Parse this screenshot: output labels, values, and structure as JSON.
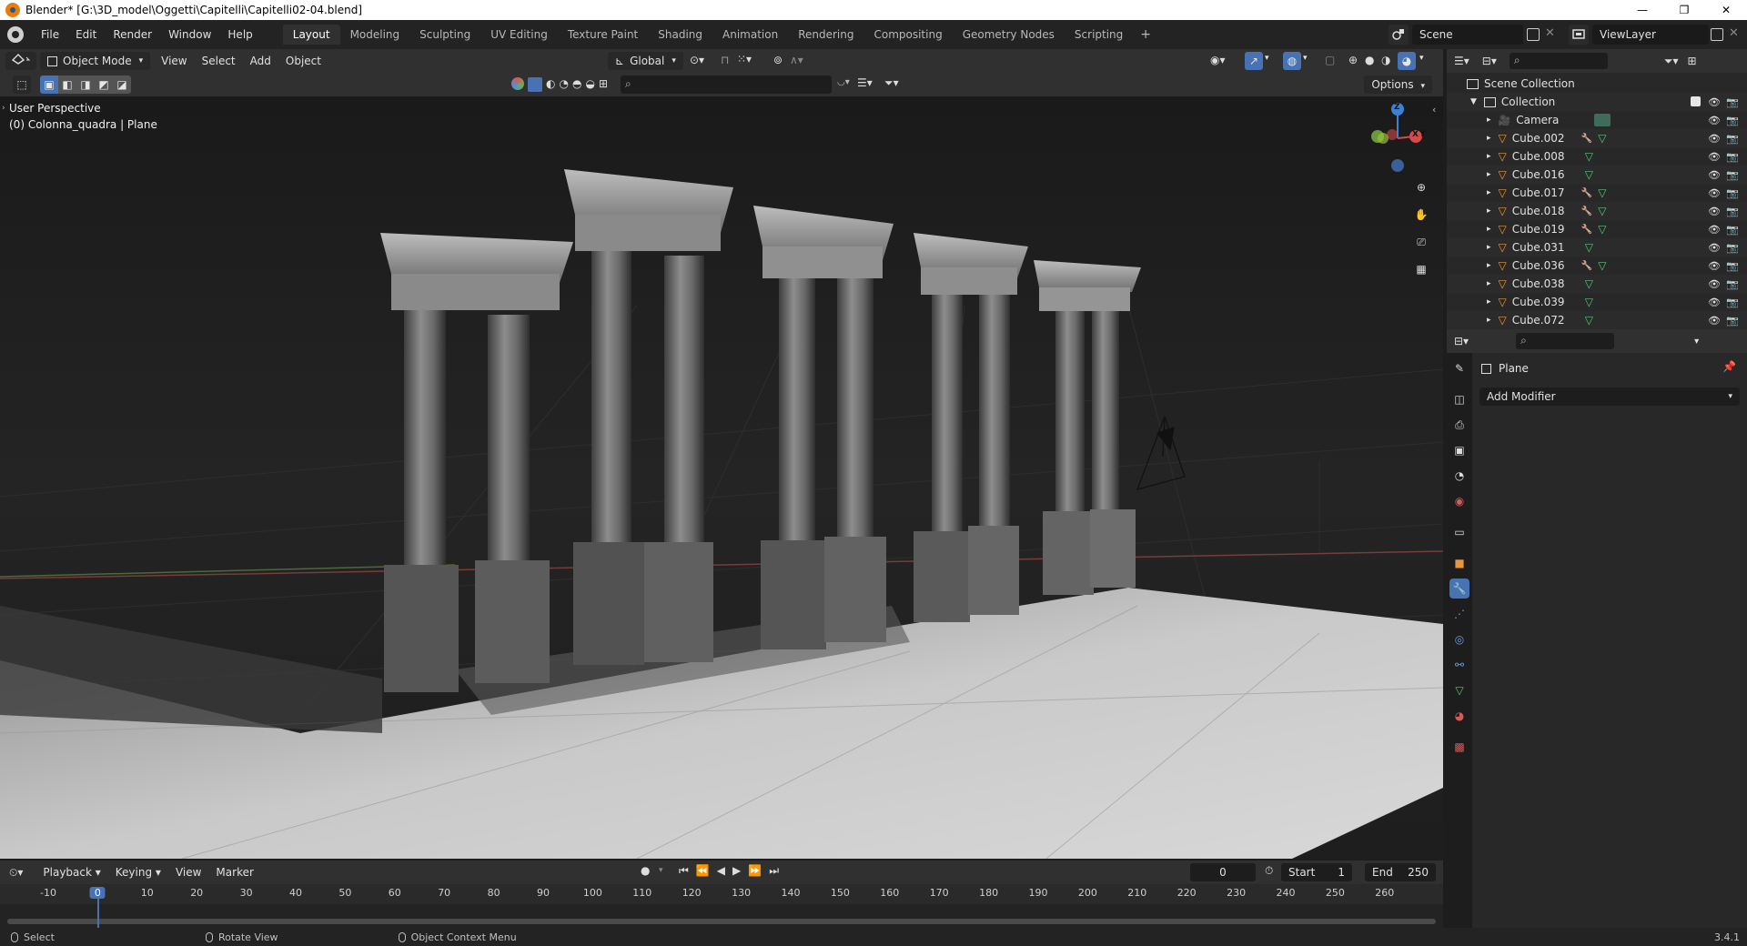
{
  "window": {
    "title": "Blender* [G:\\3D_model\\Oggetti\\Capitelli\\Capitelli02-04.blend]",
    "minimize": "—",
    "maximize": "❐",
    "close": "✕"
  },
  "menu": [
    "File",
    "Edit",
    "Render",
    "Window",
    "Help"
  ],
  "workspaces": [
    "Layout",
    "Modeling",
    "Sculpting",
    "UV Editing",
    "Texture Paint",
    "Shading",
    "Animation",
    "Rendering",
    "Compositing",
    "Geometry Nodes",
    "Scripting"
  ],
  "active_workspace": "Layout",
  "scene": {
    "name": "Scene",
    "view_layer": "ViewLayer"
  },
  "viewport_header": {
    "mode": "Object Mode",
    "menus": [
      "View",
      "Select",
      "Add",
      "Object"
    ],
    "orientation": "Global",
    "options": "Options"
  },
  "viewport": {
    "perspective": "User Perspective",
    "object_info": "(0) Colonna_quadra | Plane",
    "gizmo": {
      "z": "Z",
      "x": "X",
      "y": "Y"
    }
  },
  "outliner": {
    "scene_collection": "Scene Collection",
    "collection": "Collection",
    "items": [
      {
        "name": "Camera",
        "type": "camera",
        "modifier": false
      },
      {
        "name": "Cube.002",
        "type": "mesh",
        "modifier": true
      },
      {
        "name": "Cube.008",
        "type": "mesh",
        "modifier": false
      },
      {
        "name": "Cube.016",
        "type": "mesh",
        "modifier": false
      },
      {
        "name": "Cube.017",
        "type": "mesh",
        "modifier": true
      },
      {
        "name": "Cube.018",
        "type": "mesh",
        "modifier": true
      },
      {
        "name": "Cube.019",
        "type": "mesh",
        "modifier": true
      },
      {
        "name": "Cube.031",
        "type": "mesh",
        "modifier": false
      },
      {
        "name": "Cube.036",
        "type": "mesh",
        "modifier": true
      },
      {
        "name": "Cube.038",
        "type": "mesh",
        "modifier": false
      },
      {
        "name": "Cube.039",
        "type": "mesh",
        "modifier": false
      },
      {
        "name": "Cube.072",
        "type": "mesh",
        "modifier": false
      }
    ]
  },
  "properties": {
    "object_name": "Plane",
    "add_modifier": "Add Modifier"
  },
  "timeline": {
    "menus": [
      "Playback",
      "Keying",
      "View",
      "Marker"
    ],
    "current_frame": "0",
    "start_label": "Start",
    "start": "1",
    "end_label": "End",
    "end": "250",
    "ticks": [
      "-10",
      "0",
      "10",
      "20",
      "30",
      "40",
      "50",
      "60",
      "70",
      "80",
      "90",
      "100",
      "110",
      "120",
      "130",
      "140",
      "150",
      "160",
      "170",
      "180",
      "190",
      "200",
      "210",
      "220",
      "230",
      "240",
      "250",
      "260"
    ],
    "playhead": "0"
  },
  "status": {
    "select": "Select",
    "rotate": "Rotate View",
    "context": "Object Context Menu",
    "version": "3.4.1"
  },
  "colors": {
    "accent": "#4772b3",
    "mesh_icon": "#e8963c",
    "data_icon": "#56c47a",
    "modifier_icon": "#6d9ee8"
  }
}
